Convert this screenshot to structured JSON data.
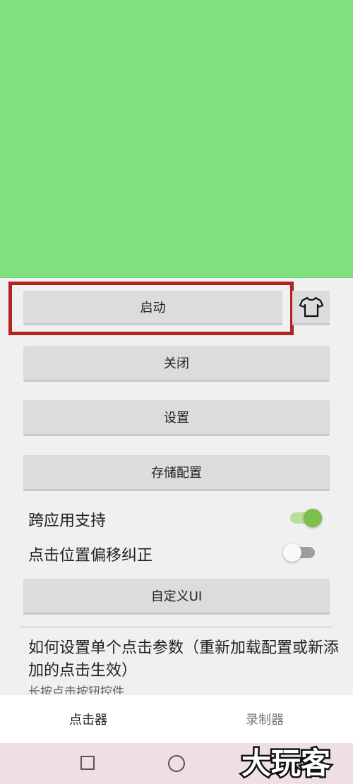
{
  "colors": {
    "banner": "#80e07e",
    "highlight_border": "#b3231f",
    "switch_on_thumb": "#7cc04b",
    "switch_on_track": "#b9df9c",
    "switch_off_thumb": "#fafafa",
    "switch_off_track": "#9e9e9e"
  },
  "buttons": {
    "start": "启动",
    "close": "关闭",
    "settings": "设置",
    "save_config": "存储配置",
    "custom_ui": "自定义UI"
  },
  "toggles": [
    {
      "label": "跨应用支持",
      "on": true
    },
    {
      "label": "点击位置偏移纠正",
      "on": false
    }
  ],
  "help": {
    "title": "如何设置单个点击参数（重新加载配置或新添加的点击生效）",
    "subtitle": "长按点击按钮控件"
  },
  "tabs": [
    {
      "label": "点击器",
      "active": true
    },
    {
      "label": "录制器",
      "active": false
    }
  ],
  "icons": {
    "theme": "shirt-icon",
    "nav_recents": "square-icon",
    "nav_home": "circle-icon"
  },
  "watermark": "大玩客"
}
